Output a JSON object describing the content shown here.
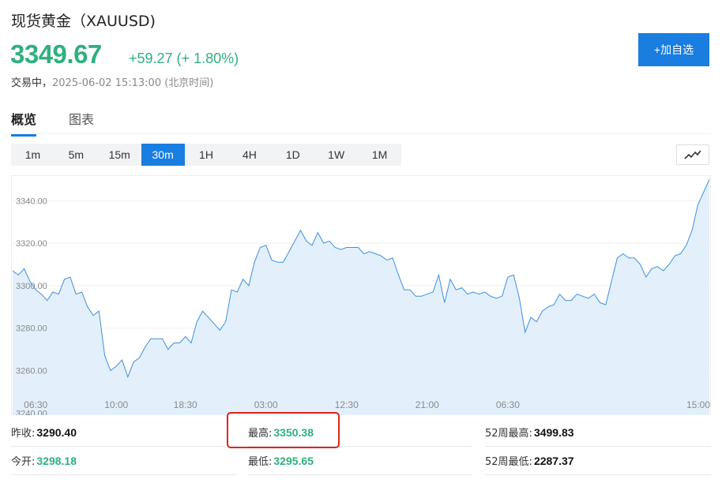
{
  "header": {
    "title": "现货黄金（XAUUSD)",
    "price": "3349.67",
    "change": "+59.27 (+ 1.80%)",
    "status_label": "交易中，",
    "timestamp": "2025-06-02 15:13:00 (北京时间)",
    "add_button": "+加自选"
  },
  "tabs": [
    {
      "label": "概览",
      "active": true
    },
    {
      "label": "图表",
      "active": false
    }
  ],
  "ranges": [
    {
      "label": "1m",
      "active": false
    },
    {
      "label": "5m",
      "active": false
    },
    {
      "label": "15m",
      "active": false
    },
    {
      "label": "30m",
      "active": true
    },
    {
      "label": "1H",
      "active": false
    },
    {
      "label": "4H",
      "active": false
    },
    {
      "label": "1D",
      "active": false
    },
    {
      "label": "1W",
      "active": false
    },
    {
      "label": "1M",
      "active": false
    }
  ],
  "chart_toggle_icon": "line-chart-icon",
  "colors": {
    "accent": "#1a7de0",
    "up": "#2fb07f",
    "line": "#3d8fe0",
    "fill": "#e3f0fc",
    "highlight": "#e0251b"
  },
  "chart_data": {
    "type": "area",
    "y_ticks": [
      "3240.00",
      "3260.00",
      "3280.00",
      "3300.00",
      "3320.00",
      "3340.00"
    ],
    "ylim": [
      3239,
      3352
    ],
    "x_ticks": [
      "06:30",
      "10:00",
      "18:30",
      "03:00",
      "12:30",
      "21:00",
      "06:30",
      "15:00"
    ],
    "x_tick_index": [
      4,
      18,
      30,
      44,
      58,
      72,
      86,
      100
    ],
    "values": [
      3307,
      3305,
      3308,
      3302,
      3298,
      3296,
      3293,
      3297,
      3296,
      3303,
      3304,
      3296,
      3297,
      3290,
      3286,
      3288,
      3267,
      3260,
      3262,
      3265,
      3257,
      3264,
      3266,
      3271,
      3275,
      3275,
      3275,
      3270,
      3273,
      3273,
      3276,
      3273,
      3283,
      3288,
      3285,
      3282,
      3279,
      3283,
      3298,
      3297,
      3303,
      3300,
      3311,
      3318,
      3319,
      3312,
      3311,
      3311,
      3316,
      3321,
      3326,
      3321,
      3319,
      3325,
      3320,
      3321,
      3318,
      3317,
      3318,
      3318,
      3318,
      3315,
      3316,
      3315,
      3314,
      3312,
      3313,
      3305,
      3298,
      3298,
      3295,
      3295,
      3296,
      3297,
      3305,
      3292,
      3303,
      3298,
      3299,
      3296,
      3297,
      3296,
      3297,
      3295,
      3294,
      3295,
      3304,
      3305,
      3294,
      3278,
      3285,
      3283,
      3288,
      3290,
      3291,
      3296,
      3293,
      3293,
      3296,
      3295,
      3294,
      3296,
      3292,
      3291,
      3302,
      3313,
      3315,
      3313,
      3313,
      3310,
      3304,
      3308,
      3309,
      3307,
      3310,
      3314,
      3315,
      3319,
      3326,
      3338,
      3344,
      3350
    ]
  },
  "stats": {
    "prev_close_label": "昨收:",
    "prev_close": "3290.40",
    "open_label": "今开:",
    "open": "3298.18",
    "high_label": "最高:",
    "high": "3350.38",
    "low_label": "最低:",
    "low": "3295.65",
    "w52_high_label": "52周最高:",
    "w52_high": "3499.83",
    "w52_low_label": "52周最低:",
    "w52_low": "2287.37"
  }
}
